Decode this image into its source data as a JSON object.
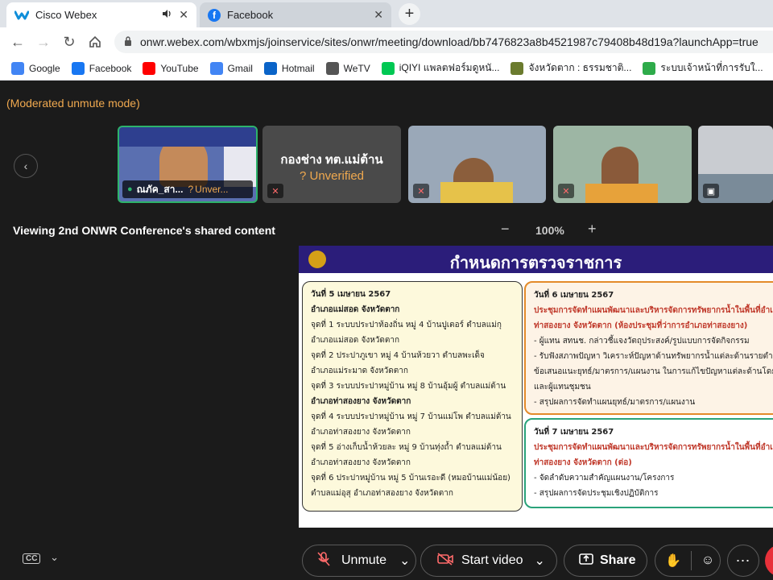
{
  "tabs": [
    {
      "title": "Cisco Webex",
      "icon": "webex-icon",
      "active": true
    },
    {
      "title": "Facebook",
      "icon": "facebook-icon",
      "active": false
    }
  ],
  "url": "onwr.webex.com/wbxmjs/joinservice/sites/onwr/meeting/download/bb7476823a8b4521987c79408b48d19a?launchApp=true",
  "bookmarks": [
    {
      "label": "Google",
      "icon": "google-icon",
      "color": "#4285f4"
    },
    {
      "label": "Facebook",
      "icon": "facebook-icon",
      "color": "#1877f2"
    },
    {
      "label": "YouTube",
      "icon": "youtube-icon",
      "color": "#ff0000"
    },
    {
      "label": "Gmail",
      "icon": "google-icon",
      "color": "#4285f4"
    },
    {
      "label": "Hotmail",
      "icon": "outlook-icon",
      "color": "#0a64c8"
    },
    {
      "label": "WeTV",
      "icon": "globe-icon",
      "color": "#555555"
    },
    {
      "label": "iQIYI แพลตฟอร์มดูหนั...",
      "icon": "iqiyi-icon",
      "color": "#00c853"
    },
    {
      "label": "จังหวัดตาก : ธรรมชาติ...",
      "icon": "seal-icon",
      "color": "#6b7b2e"
    },
    {
      "label": "ระบบเจ้าหน้าที่การรับใ...",
      "icon": "leaf-icon",
      "color": "#2eab4a"
    }
  ],
  "meeting": {
    "mode_text": "(Moderated unmute mode)",
    "participants": [
      {
        "name": "ณภัค_สา...",
        "status": "Unver..."
      },
      {
        "name": "กองช่าง ทต.แม่ต้าน",
        "status": "Unverified"
      },
      {
        "name": "",
        "status": ""
      },
      {
        "name": "",
        "status": ""
      },
      {
        "name": "",
        "status": ""
      }
    ],
    "viewing_text": "Viewing 2nd ONWR Conference's shared content",
    "zoom_minus": "−",
    "zoom_level": "100%",
    "zoom_plus": "+"
  },
  "slide": {
    "title": "กำหนดการตรวจราชการ",
    "left_box": [
      {
        "text": "วันที่ 5 เมษายน 2567",
        "style": "b"
      },
      {
        "text": "อำเภอแม่สอด จังหวัดตาก",
        "style": "b"
      },
      {
        "text": "จุดที่ 1 ระบบประปาท้องถิ่น หมู่ 4 บ้านปูเตอร์ ตำบลแม่กุ",
        "style": ""
      },
      {
        "text": "อำเภอแม่สอด จังหวัดตาก",
        "style": ""
      },
      {
        "text": "จุดที่ 2 ประปาภูเขา หมู่ 4 บ้านห้วยวา ตำบลพะเด็จ",
        "style": ""
      },
      {
        "text": "อำเภอแม่ระมาด จังหวัดตาก",
        "style": ""
      },
      {
        "text": "จุดที่ 3 ระบบประปาหมู่บ้าน หมู่ 8 บ้านอุ้มผู้ ตำบลแม่ต้าน",
        "style": ""
      },
      {
        "text": "อำเภอท่าสองยาง จังหวัดตาก",
        "style": "b"
      },
      {
        "text": "จุดที่ 4 ระบบประปาหมู่บ้าน หมู่ 7 บ้านแม่โพ ตำบลแม่ต้าน",
        "style": ""
      },
      {
        "text": "อำเภอท่าสองยาง จังหวัดตาก",
        "style": ""
      },
      {
        "text": "จุดที่ 5 อ่างเก็บน้ำห้วยละ หมู่ 9 บ้านทุ่งถ้ำ ตำบลแม่ต้าน",
        "style": ""
      },
      {
        "text": "อำเภอท่าสองยาง จังหวัดตาก",
        "style": ""
      },
      {
        "text": "จุดที่ 6 ประปาหมู่บ้าน หมู่ 5 บ้านเรอะดี (หมอบ้านแม่น้อย)",
        "style": ""
      },
      {
        "text": "ตำบลแม่อุสุ อำเภอท่าสองยาง จังหวัดตาก",
        "style": ""
      }
    ],
    "right_box_1": [
      {
        "text": "วันที่ 6 เมษายน 2567",
        "style": "b"
      },
      {
        "text": "ประชุมการจัดทำแผนพัฒนาและบริหารจัดการทรัพยากรน้ำในพื้นที่อำเภ",
        "style": "r"
      },
      {
        "text": "ท่าสองยาง จังหวัดตาก (ห้องประชุมที่ว่าการอำเภอท่าสองยาง)",
        "style": "r"
      },
      {
        "text": "- ผู้แทน สทนช. กล่าวชี้แจงวัตถุประสงค์/รูปแบบการจัดกิจกรรม",
        "style": ""
      },
      {
        "text": "- รับฟังสภาพปัญหา วิเคราะห์ปัญหาด้านทรัพยากรน้ำแต่ละด้านรายตำบล",
        "style": ""
      },
      {
        "text": "  ข้อเสนอแนะยุทธ์/มาตรการ/แผนงาน ในการแก้ไขปัญหาแต่ละด้านโดยหน",
        "style": ""
      },
      {
        "text": "และผู้แทนชุมชน",
        "style": ""
      },
      {
        "text": "- สรุปผลการจัดทำแผนยุทธ์/มาตรการ/แผนงาน",
        "style": ""
      }
    ],
    "right_box_2": [
      {
        "text": "วันที่ 7 เมษายน 2567",
        "style": "b"
      },
      {
        "text": "ประชุมการจัดทำแผนพัฒนาและบริหารจัดการทรัพยากรน้ำในพื้นที่อำเภ",
        "style": "r"
      },
      {
        "text": "ท่าสองยาง จังหวัดตาก (ต่อ)",
        "style": "r"
      },
      {
        "text": "- จัดลำดับความสำคัญแผนงาน/โครงการ",
        "style": ""
      },
      {
        "text": "- สรุปผลการจัดประชุมเชิงปฏิบัติการ",
        "style": ""
      }
    ]
  },
  "controls": {
    "unmute_label": "Unmute",
    "start_video_label": "Start video",
    "share_label": "Share"
  }
}
